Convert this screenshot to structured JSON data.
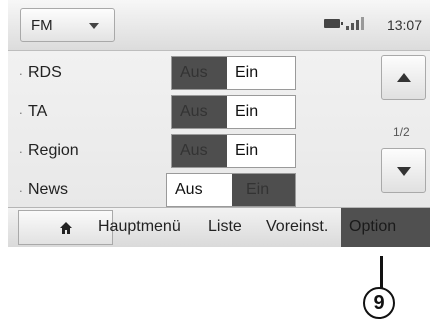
{
  "header": {
    "source": "FM",
    "clock": "13:07",
    "icons": [
      "dropdown-caret",
      "battery-icon",
      "signal-icon"
    ]
  },
  "settings": [
    {
      "label": "RDS",
      "off": "Aus",
      "on": "Ein",
      "value": "Aus"
    },
    {
      "label": "TA",
      "off": "Aus",
      "on": "Ein",
      "value": "Aus"
    },
    {
      "label": "Region",
      "off": "Aus",
      "on": "Ein",
      "value": "Aus"
    },
    {
      "label": "News",
      "off": "Aus",
      "on": "Ein",
      "value": "Ein"
    }
  ],
  "pager": {
    "page": "1/2"
  },
  "bottom": {
    "home": "home-icon",
    "items": [
      "Hauptmenü",
      "Liste",
      "Voreinst.",
      "Option"
    ]
  },
  "callout": {
    "number": "9"
  },
  "colors": {
    "selected": "#4e4e4e",
    "background": "#ececec"
  }
}
